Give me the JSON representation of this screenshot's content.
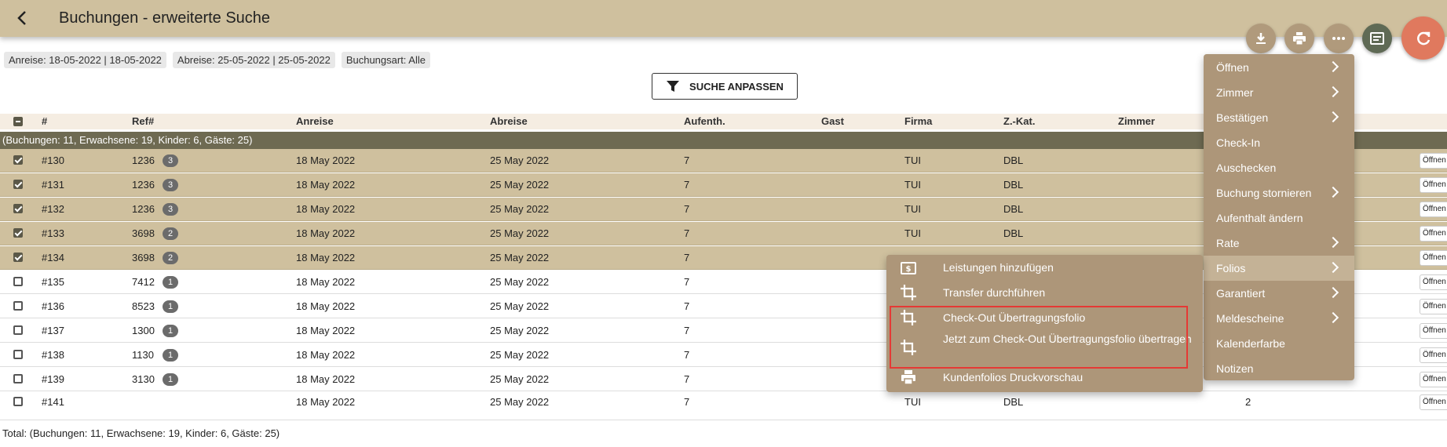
{
  "header": {
    "title": "Buchungen - erweiterte Suche",
    "back_icon": "arrow-left-icon"
  },
  "toolbar": {
    "icons": [
      "download-icon",
      "print-icon",
      "more-horiz-icon",
      "view-icon",
      "refresh-icon"
    ],
    "accent_refresh": "#e0795e",
    "accent_dark": "#5f6a55"
  },
  "filters": [
    "Anreise: 18-05-2022 | 18-05-2022",
    "Abreise: 25-05-2022 | 25-05-2022",
    "Buchungsart: Alle"
  ],
  "search_button": {
    "label": "SUCHE ANPASSEN"
  },
  "table": {
    "columns": [
      "#",
      "Ref#",
      "Anreise",
      "Abreise",
      "Aufenth.",
      "Gast",
      "Firma",
      "Z.-Kat.",
      "Zimmer"
    ],
    "summary": "(Buchungen: 11, Erwachsene: 19, Kinder: 6, Gäste: 25)",
    "open_label": "Öffnen",
    "rows": [
      {
        "id": "#130",
        "ref": "1236",
        "badge": "3",
        "anreise": "18 May 2022",
        "abreise": "25 May 2022",
        "aufenth": "7",
        "firma": "TUI",
        "zkat": "DBL",
        "extra": "",
        "selected": true
      },
      {
        "id": "#131",
        "ref": "1236",
        "badge": "3",
        "anreise": "18 May 2022",
        "abreise": "25 May 2022",
        "aufenth": "7",
        "firma": "TUI",
        "zkat": "DBL",
        "extra": "",
        "selected": true
      },
      {
        "id": "#132",
        "ref": "1236",
        "badge": "3",
        "anreise": "18 May 2022",
        "abreise": "25 May 2022",
        "aufenth": "7",
        "firma": "TUI",
        "zkat": "DBL",
        "extra": "",
        "selected": true
      },
      {
        "id": "#133",
        "ref": "3698",
        "badge": "2",
        "anreise": "18 May 2022",
        "abreise": "25 May 2022",
        "aufenth": "7",
        "firma": "TUI",
        "zkat": "DBL",
        "extra": "",
        "selected": true
      },
      {
        "id": "#134",
        "ref": "3698",
        "badge": "2",
        "anreise": "18 May 2022",
        "abreise": "25 May 2022",
        "aufenth": "7",
        "firma": "",
        "zkat": "",
        "extra": "",
        "selected": true
      },
      {
        "id": "#135",
        "ref": "7412",
        "badge": "1",
        "anreise": "18 May 2022",
        "abreise": "25 May 2022",
        "aufenth": "7",
        "firma": "",
        "zkat": "",
        "extra": "",
        "selected": false
      },
      {
        "id": "#136",
        "ref": "8523",
        "badge": "1",
        "anreise": "18 May 2022",
        "abreise": "25 May 2022",
        "aufenth": "7",
        "firma": "",
        "zkat": "",
        "extra": "",
        "selected": false
      },
      {
        "id": "#137",
        "ref": "1300",
        "badge": "1",
        "anreise": "18 May 2022",
        "abreise": "25 May 2022",
        "aufenth": "7",
        "firma": "",
        "zkat": "",
        "extra": "",
        "selected": false
      },
      {
        "id": "#138",
        "ref": "1130",
        "badge": "1",
        "anreise": "18 May 2022",
        "abreise": "25 May 2022",
        "aufenth": "7",
        "firma": "",
        "zkat": "",
        "extra": "",
        "selected": false
      },
      {
        "id": "#139",
        "ref": "3130",
        "badge": "1",
        "anreise": "18 May 2022",
        "abreise": "25 May 2022",
        "aufenth": "7",
        "firma": "",
        "zkat": "",
        "extra": "",
        "selected": false
      },
      {
        "id": "#141",
        "ref": "",
        "badge": "",
        "anreise": "18 May 2022",
        "abreise": "25 May 2022",
        "aufenth": "7",
        "firma": "TUI",
        "zkat": "DBL",
        "extra": "2",
        "selected": false
      }
    ],
    "total": "Total: (Buchungen: 11, Erwachsene: 19, Kinder: 6, Gäste: 25)"
  },
  "context_menu": {
    "items": [
      {
        "label": "Öffnen",
        "submenu": true
      },
      {
        "label": "Zimmer",
        "submenu": true
      },
      {
        "label": "Bestätigen",
        "submenu": true
      },
      {
        "label": "Check-In",
        "submenu": false
      },
      {
        "label": "Auschecken",
        "submenu": false
      },
      {
        "label": "Buchung stornieren",
        "submenu": true
      },
      {
        "label": "Aufenthalt ändern",
        "submenu": false
      },
      {
        "label": "Rate",
        "submenu": true
      },
      {
        "label": "Folios",
        "submenu": true,
        "active": true
      },
      {
        "label": "Garantiert",
        "submenu": true
      },
      {
        "label": "Meldescheine",
        "submenu": true
      },
      {
        "label": "Kalenderfarbe",
        "submenu": false
      },
      {
        "label": "Notizen",
        "submenu": false
      }
    ]
  },
  "folios_submenu": {
    "items": [
      {
        "label": "Leistungen hinzufügen",
        "icon": "dollar-receipt-icon"
      },
      {
        "label": "Transfer durchführen",
        "icon": "crop-transfer-icon"
      },
      {
        "label": "Check-Out Übertragungsfolio",
        "icon": "crop-transfer-icon"
      },
      {
        "label": "Jetzt zum Check-Out Übertragungsfolio übertragen",
        "icon": "crop-transfer-icon"
      },
      {
        "label": "Kundenfolios Druckvorschau",
        "icon": "print-icon"
      }
    ],
    "highlight_color": "#e53935"
  }
}
